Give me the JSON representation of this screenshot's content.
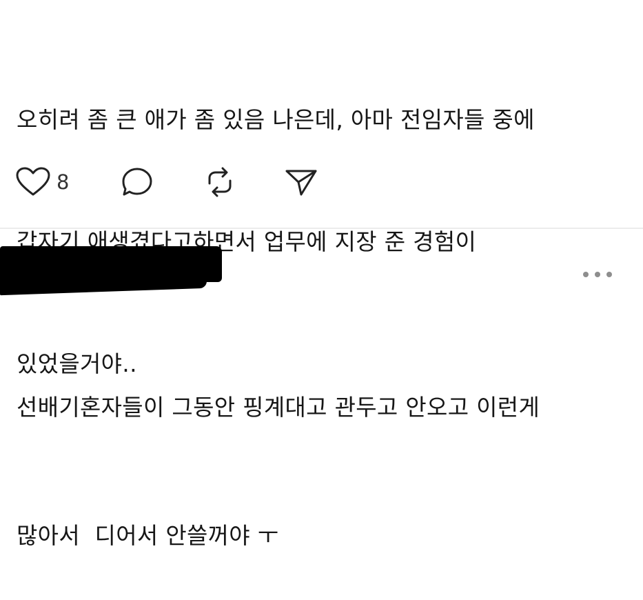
{
  "post": {
    "lines": [
      "오히려 좀 큰 애가 좀 있음 나은데, 아마 전임자들 중에",
      "갑자기 애생겼다고하면서 업무에 지장 준 경험이",
      "있었을거야.."
    ],
    "like_count": "8",
    "icons": {
      "like": "heart-icon",
      "comment": "comment-icon",
      "repost": "repost-icon",
      "share": "send-icon"
    }
  },
  "reply": {
    "author_redacted": true,
    "more_icon": "more-horizontal-icon",
    "lines": [
      "선배기혼자들이 그동안 핑계대고 관두고 안오고 이런게",
      "많아서  디어서 안쓸꺼야 ㅜ"
    ]
  },
  "colors": {
    "text": "#161616",
    "icon": "#222222",
    "divider": "#ececec",
    "muted": "#8e8e8e"
  }
}
